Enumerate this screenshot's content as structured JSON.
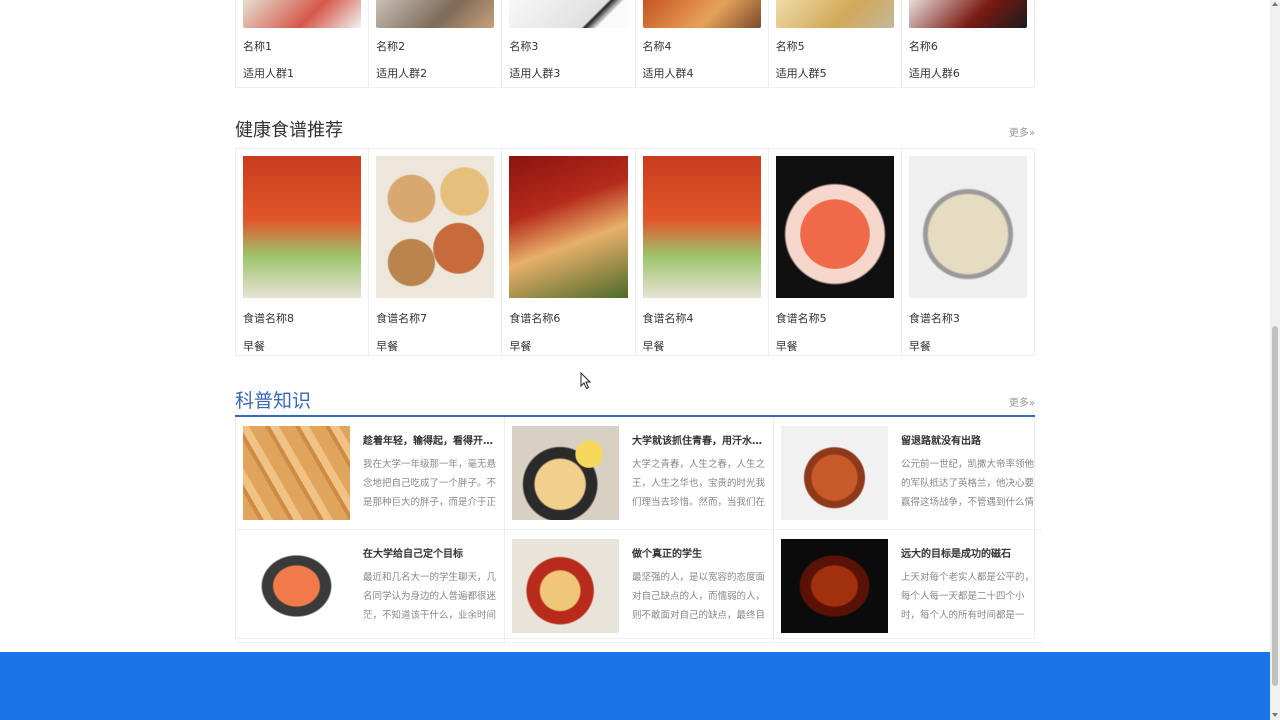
{
  "top_cards": [
    {
      "name": "名称1",
      "group": "适用人群1"
    },
    {
      "name": "名称2",
      "group": "适用人群2"
    },
    {
      "name": "名称3",
      "group": "适用人群3"
    },
    {
      "name": "名称4",
      "group": "适用人群4"
    },
    {
      "name": "名称5",
      "group": "适用人群5"
    },
    {
      "name": "名称6",
      "group": "适用人群6"
    }
  ],
  "recipes": {
    "title": "健康食谱推荐",
    "more": "更多»",
    "items": [
      {
        "name": "食谱名称8",
        "meal": "早餐"
      },
      {
        "name": "食谱名称7",
        "meal": "早餐"
      },
      {
        "name": "食谱名称6",
        "meal": "早餐"
      },
      {
        "name": "食谱名称4",
        "meal": "早餐"
      },
      {
        "name": "食谱名称5",
        "meal": "早餐"
      },
      {
        "name": "食谱名称3",
        "meal": "早餐"
      }
    ]
  },
  "science": {
    "title": "科普知识",
    "more": "更多»",
    "articles": [
      {
        "title": "趁着年轻，输得起，看得开，...",
        "text": "我在大学一年级那一年，毫无悬念地把自己吃成了一个胖子。不是那种巨大的胖子，而是介于正"
      },
      {
        "title": "大学就该抓住青春，用汗水实...",
        "text": "大学之青春，人生之春，人生之王，人生之华也，宝贵的时光我们理当去珍惜。然而，当我们在"
      },
      {
        "title": "留退路就没有出路",
        "text": "公元前一世纪，凯撒大帝率领他的军队抵达了英格兰，他决心要赢得这场战争，不管遇到什么情"
      },
      {
        "title": "在大学给自己定个目标",
        "text": "最近和几名大一的学生聊天，几名同学认为身边的人普遍都很迷茫，不知道该干什么，业余时间"
      },
      {
        "title": "做个真正的学生",
        "text": "最坚强的人，是以宽容的态度面对自己缺点的人，而懦弱的人，则不敢面对自己的缺点，最终目"
      },
      {
        "title": "远大的目标是成功的磁石",
        "text": "上天对每个老实人都是公平的，每个人每一天都是二十四个小时，每个人的所有时间都是一"
      }
    ]
  }
}
